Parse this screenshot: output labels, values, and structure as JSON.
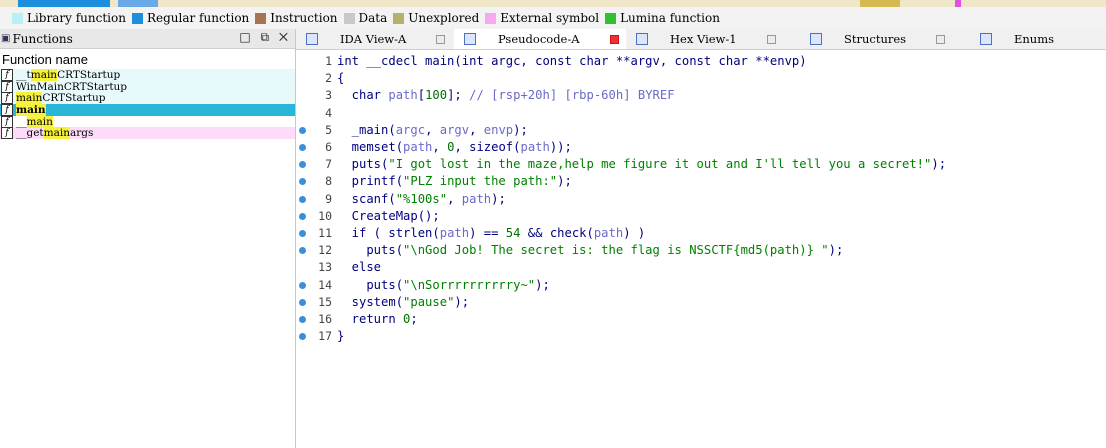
{
  "legend": [
    {
      "label": "Library function",
      "color": "#b9f0f6"
    },
    {
      "label": "Regular function",
      "color": "#1c8fdc"
    },
    {
      "label": "Instruction",
      "color": "#a87352"
    },
    {
      "label": "Data",
      "color": "#c8c8c8"
    },
    {
      "label": "Unexplored",
      "color": "#b3b26d"
    },
    {
      "label": "External symbol",
      "color": "#f7a8f0"
    },
    {
      "label": "Lumina function",
      "color": "#30c030"
    }
  ],
  "functions_panel": {
    "title": "Functions",
    "column_header": "Function name",
    "items": [
      {
        "prefix": "__t",
        "hl": "main",
        "suffix": "CRTStartup",
        "bg": "#e8f9fb"
      },
      {
        "prefix": "WinMain",
        "hl": "",
        "suffix": "CRTStartup",
        "bg": "#e8f9fb"
      },
      {
        "prefix": "",
        "hl": "main",
        "suffix": "CRTStartup",
        "bg": "#e8f9fb"
      },
      {
        "prefix": "",
        "hl": "main",
        "suffix": "",
        "bg": "#29b6d8"
      },
      {
        "prefix": "__",
        "hl": "main",
        "suffix": "",
        "bg": "#ffffff"
      },
      {
        "prefix": "__get",
        "hl": "main",
        "suffix": "args",
        "bg": "#fcdcf8"
      }
    ]
  },
  "tabs": [
    {
      "label": "IDA View-A",
      "active": false
    },
    {
      "label": "Pseudocode-A",
      "active": true
    },
    {
      "label": "Hex View-1",
      "active": false
    },
    {
      "label": "Structures",
      "active": false
    },
    {
      "label": "Enums",
      "active": false
    }
  ],
  "code": [
    {
      "n": "1",
      "bp": false,
      "html": "int __cdecl main(int argc, const char **argv, const char **envp)"
    },
    {
      "n": "2",
      "bp": false,
      "text": "{"
    },
    {
      "n": "3",
      "bp": false,
      "text": "  char path[100]; // [rsp+20h] [rbp-60h] BYREF"
    },
    {
      "n": "4",
      "bp": false,
      "text": ""
    },
    {
      "n": "5",
      "bp": true,
      "text": "  _main(argc, argv, envp);"
    },
    {
      "n": "6",
      "bp": true,
      "text": "  memset(path, 0, sizeof(path));"
    },
    {
      "n": "7",
      "bp": true,
      "text": "  puts(\"I got lost in the maze,help me figure it out and I'll tell you a secret!\");"
    },
    {
      "n": "8",
      "bp": true,
      "text": "  printf(\"PLZ input the path:\");"
    },
    {
      "n": "9",
      "bp": true,
      "text": "  scanf(\"%100s\", path);"
    },
    {
      "n": "10",
      "bp": true,
      "text": "  CreateMap();"
    },
    {
      "n": "11",
      "bp": true,
      "text": "  if ( strlen(path) == 54 && check(path) )"
    },
    {
      "n": "12",
      "bp": true,
      "text": "    puts(\"\\nGod Job! The secret is: the flag is NSSCTF{md5(path)} \");"
    },
    {
      "n": "13",
      "bp": false,
      "text": "  else"
    },
    {
      "n": "14",
      "bp": true,
      "text": "    puts(\"\\nSorrrrrrrrrry~\");"
    },
    {
      "n": "15",
      "bp": true,
      "text": "  system(\"pause\");"
    },
    {
      "n": "16",
      "bp": true,
      "text": "  return 0;"
    },
    {
      "n": "17",
      "bp": true,
      "text": "}"
    }
  ]
}
